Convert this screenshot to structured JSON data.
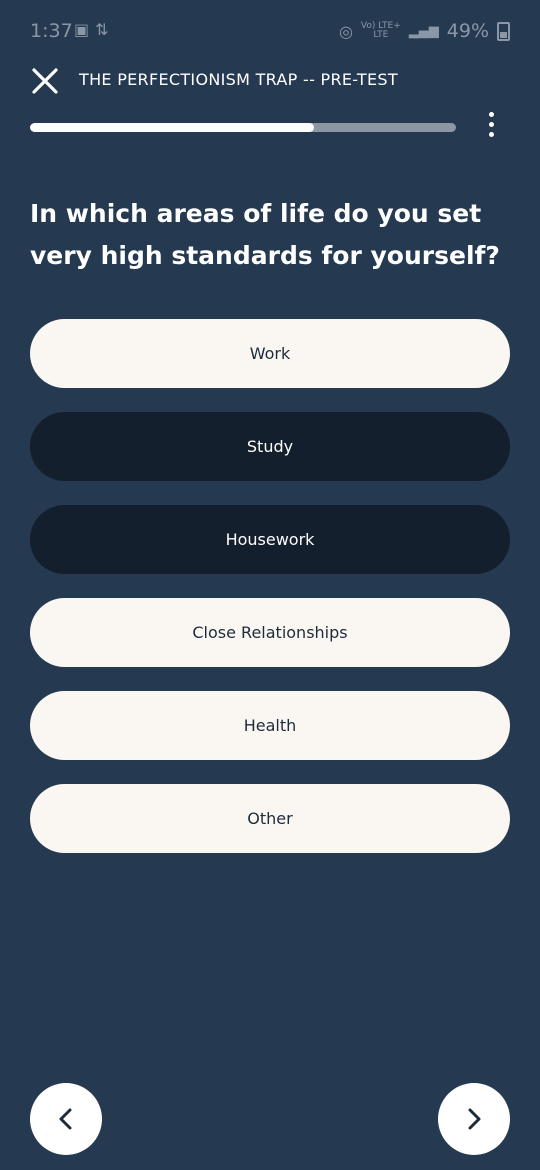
{
  "status_bar": {
    "time": "1:37",
    "network_top": "Vo) LTE+",
    "network_bottom": "LTE",
    "battery": "49%"
  },
  "header": {
    "title": "THE PERFECTIONISM TRAP -- PRE-TEST",
    "close_icon": "close-icon",
    "more_icon": "more-vertical-icon"
  },
  "progress": {
    "fraction": 0.667
  },
  "question": "In which areas of life do you set very high standards for yourself?",
  "options": [
    {
      "label": "Work",
      "selected": false
    },
    {
      "label": "Study",
      "selected": true
    },
    {
      "label": "Housework",
      "selected": true
    },
    {
      "label": "Close Relationships",
      "selected": false
    },
    {
      "label": "Health",
      "selected": false
    },
    {
      "label": "Other",
      "selected": false
    }
  ],
  "nav": {
    "prev_icon": "chevron-left-icon",
    "next_icon": "chevron-right-icon"
  },
  "colors": {
    "background": "#253950",
    "option_light": "#faf7f3",
    "option_selected": "#131f2c",
    "progress_track": "#8d97a3"
  }
}
